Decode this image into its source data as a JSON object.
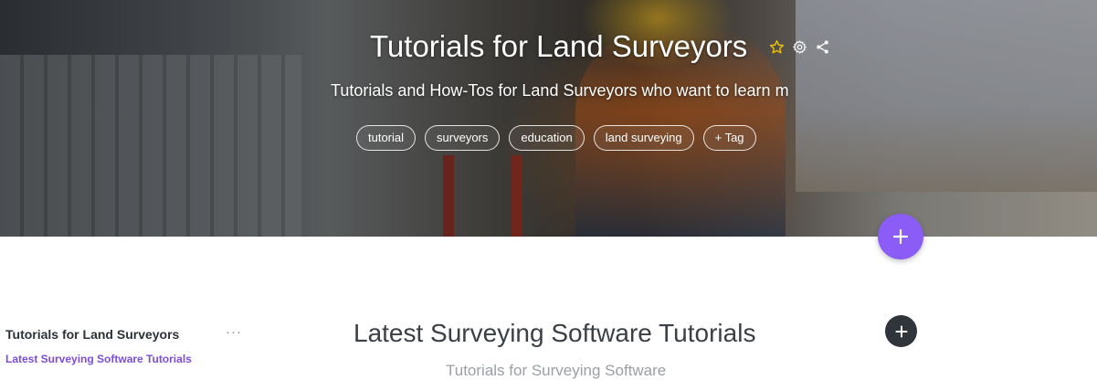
{
  "hero": {
    "title": "Tutorials for Land Surveyors",
    "subtitle": "Tutorials and How-Tos for Land Surveyors who want to learn m",
    "icons": [
      "star-icon",
      "gear-icon",
      "share-icon"
    ],
    "tags": [
      "tutorial",
      "surveyors",
      "education",
      "land surveying",
      "+ Tag"
    ]
  },
  "sidebar": {
    "title": "Tutorials for Land Surveyors",
    "more": "···",
    "links": [
      "Latest Surveying Software Tutorials"
    ]
  },
  "main": {
    "title": "Latest Surveying Software Tutorials",
    "subtitle": "Tutorials for Surveying Software"
  },
  "colors": {
    "accent": "#8b5cf6",
    "link": "#7c4ddb",
    "star": "#f2c200",
    "dark_button": "#2f353b"
  }
}
